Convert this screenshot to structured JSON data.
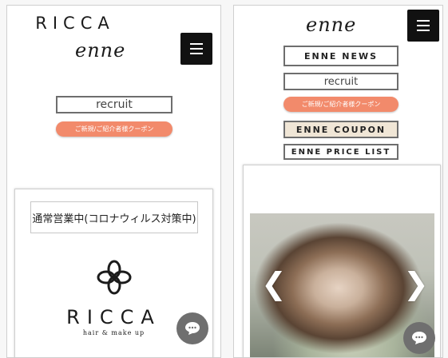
{
  "left": {
    "brand": "RICCA",
    "script_logo": "enne",
    "recruit_label": "recruit",
    "coupon_label": "ご新規/ご紹介者様クーポン",
    "status_text": "通常営業中(コロナウィルス対策中)",
    "ricca_logo": "RICCA",
    "ricca_tagline": "hair & make up"
  },
  "right": {
    "script_logo": "enne",
    "news_label": "ENNE NEWS",
    "recruit_label": "recruit",
    "coupon_label": "ご新規/ご紹介者様クーポン",
    "enne_coupon_label": "ENNE COUPON",
    "price_list_label": "ENNE PRICE LIST",
    "prev_arrow": "❮",
    "next_arrow": "❯"
  },
  "colors": {
    "coral": "#f28a6b",
    "beige": "#f0e6d6",
    "dark": "#111111",
    "chat": "#6f6f6f"
  },
  "icons": [
    "hamburger-menu-icon",
    "chat-bubble-icon",
    "ricca-flower-logo-icon",
    "chevron-left-icon",
    "chevron-right-icon"
  ]
}
